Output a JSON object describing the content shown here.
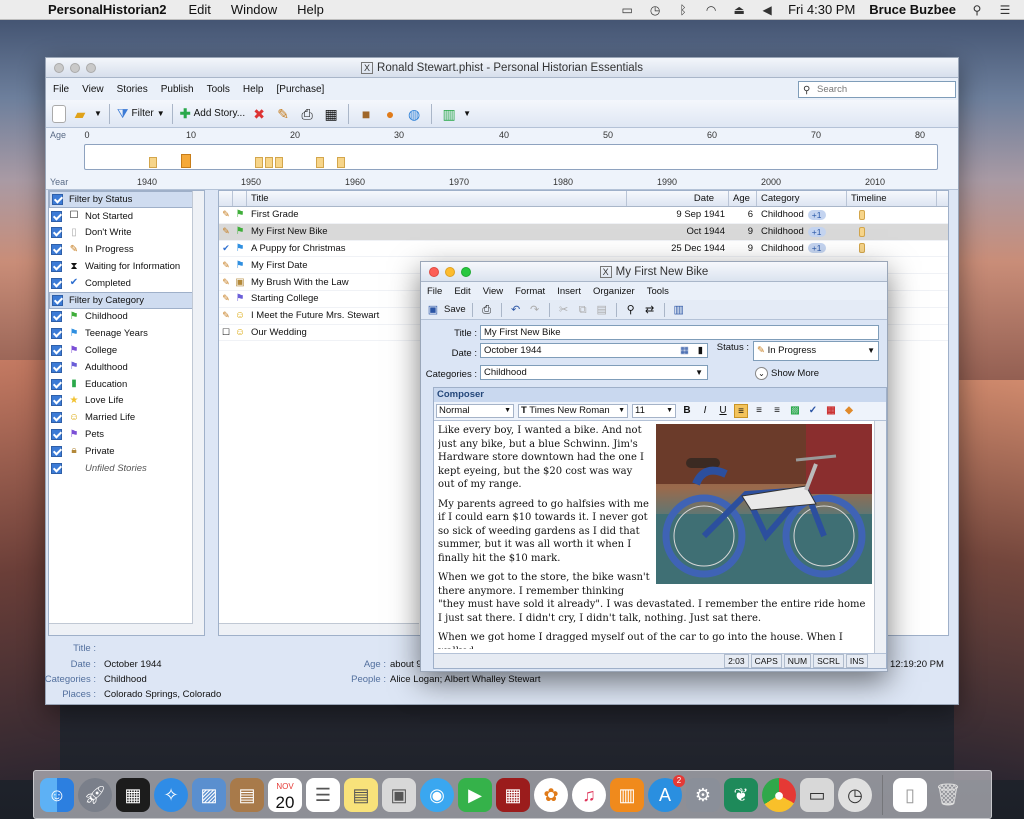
{
  "menubar": {
    "app_name": "PersonalHistorian2",
    "items": [
      "Edit",
      "Window",
      "Help"
    ],
    "clock": "Fri 4:30 PM",
    "user": "Bruce Buzbee"
  },
  "main_window": {
    "title": "Ronald Stewart.phist - Personal Historian Essentials",
    "menu": [
      "File",
      "View",
      "Stories",
      "Publish",
      "Tools",
      "Help",
      "[Purchase]"
    ],
    "search_placeholder": "Search",
    "toolbar": {
      "filter_label": "Filter",
      "add_story_label": "Add Story..."
    },
    "ruler": {
      "age_label": "Age",
      "year_label": "Year",
      "age_ticks": [
        "0",
        "10",
        "20",
        "30",
        "40",
        "50",
        "60",
        "70",
        "80"
      ],
      "year_ticks": [
        "1940",
        "1950",
        "1960",
        "1970",
        "1980",
        "1990",
        "2000",
        "2010"
      ]
    },
    "filters": {
      "status_header": "Filter by Status",
      "status": [
        {
          "label": "Not Started",
          "icon": "empty-box-icon"
        },
        {
          "label": "Don't Write",
          "icon": "blank-page-icon"
        },
        {
          "label": "In Progress",
          "icon": "pencil-icon"
        },
        {
          "label": "Waiting for Information",
          "icon": "hourglass-icon"
        },
        {
          "label": "Completed",
          "icon": "check-pencil-icon"
        }
      ],
      "category_header": "Filter by Category",
      "categories": [
        {
          "label": "Childhood",
          "color": "#3fae3a"
        },
        {
          "label": "Teenage Years",
          "color": "#2f8fe0"
        },
        {
          "label": "College",
          "color": "#7b4fd6"
        },
        {
          "label": "Adulthood",
          "color": "#6a5ed8"
        },
        {
          "label": "Education",
          "color": "#2aa84a"
        },
        {
          "label": "Love Life",
          "color": "#f2c230"
        },
        {
          "label": "Married Life",
          "color": "#f2c230"
        },
        {
          "label": "Pets",
          "color": "#7b4fd6"
        },
        {
          "label": "Private",
          "color": "#d9a441"
        },
        {
          "label": "Unfiled Stories",
          "color": "#888888"
        }
      ]
    },
    "list": {
      "columns": {
        "title": "Title",
        "date": "Date",
        "age": "Age",
        "category": "Category",
        "timeline": "Timeline"
      },
      "rows": [
        {
          "title": "First Grade",
          "date": "9 Sep 1941",
          "age": "6",
          "category": "Childhood",
          "extra": "+1",
          "status_icon": "pencil-icon",
          "flag": "#3fae3a",
          "checked": false
        },
        {
          "title": "My First New Bike",
          "date": "Oct 1944",
          "age": "9",
          "category": "Childhood",
          "extra": "+1",
          "status_icon": "pencil-icon",
          "flag": "#3fae3a",
          "checked": false,
          "selected": true
        },
        {
          "title": "A Puppy for Christmas",
          "date": "25 Dec 1944",
          "age": "9",
          "category": "Childhood",
          "extra": "+1",
          "status_icon": "check-pencil-icon",
          "flag": "#2f8fe0",
          "checked": false
        },
        {
          "title": "My First Date",
          "date": "",
          "age": "",
          "category": "",
          "extra": "",
          "status_icon": "pencil-icon",
          "flag": "#2f8fe0",
          "checked": false
        },
        {
          "title": "My Brush With the Law",
          "date": "",
          "age": "",
          "category": "",
          "extra": "",
          "status_icon": "pencil-icon",
          "flag": "#d9a441",
          "checked": false
        },
        {
          "title": "Starting College",
          "date": "",
          "age": "",
          "category": "",
          "extra": "",
          "status_icon": "pencil-icon",
          "flag": "#6a5ed8",
          "checked": false
        },
        {
          "title": "I Meet the Future Mrs. Stewart",
          "date": "",
          "age": "",
          "category": "",
          "extra": "",
          "status_icon": "pencil-icon",
          "flag": "#f2c230",
          "checked": false
        },
        {
          "title": "Our Wedding",
          "date": "",
          "age": "",
          "category": "",
          "extra": "",
          "status_icon": "empty-box-icon",
          "flag": "#f2c230",
          "checked": false
        }
      ]
    },
    "detail": {
      "title_label": "Title :",
      "date_label": "Date :",
      "date_value": "October 1944",
      "categories_label": "Categories :",
      "categories_value": "Childhood",
      "places_label": "Places :",
      "places_value": "Colorado Springs, Colorado",
      "age_label": "Age :",
      "age_value": "about 9",
      "people_label": "People :",
      "people_value": "Alice Logan; Albert Whalley Stewart",
      "time_value": "12:19:20 PM"
    }
  },
  "dialog": {
    "title": "My First New Bike",
    "menu": [
      "File",
      "Edit",
      "View",
      "Format",
      "Insert",
      "Organizer",
      "Tools"
    ],
    "save_label": "Save",
    "title_label": "Title :",
    "title_value": "My First New Bike",
    "date_label": "Date :",
    "date_value": "October 1944",
    "status_label": "Status :",
    "status_value": "In Progress",
    "categories_label": "Categories :",
    "categories_value": "Childhood",
    "show_more": "Show More",
    "composer_label": "Composer",
    "style_value": "Normal",
    "font_value": "Times New Roman",
    "size_value": "11",
    "paragraphs": [
      "Like every boy, I wanted a bike.  And not just any bike, but a blue Schwinn.  Jim's Hardware store downtown had the one I kept eyeing, but the $20 cost was way out of my range.",
      "My parents agreed to go halfsies with me if I could earn $10 towards it.  I never got so sick of weeding gardens as I did that summer, but it was all worth it when I finally hit the $10 mark.",
      "When we got to the store, the bike wasn't there anymore.  I remember thinking \"they must have sold it already\".  I was devastated.  I remember the entire ride home I just sat there.  I didn't cry, I didn't talk, nothing.  Just sat there.",
      "When we got home I dragged myself out of the car to go into the house.  When I walked"
    ],
    "status_bar": {
      "position": "2:03",
      "caps": "CAPS",
      "num": "NUM",
      "scrl": "SCRL",
      "ins": "INS"
    }
  },
  "dock": {
    "calendar_month": "NOV",
    "calendar_day": "20",
    "appstore_badge": "2"
  }
}
